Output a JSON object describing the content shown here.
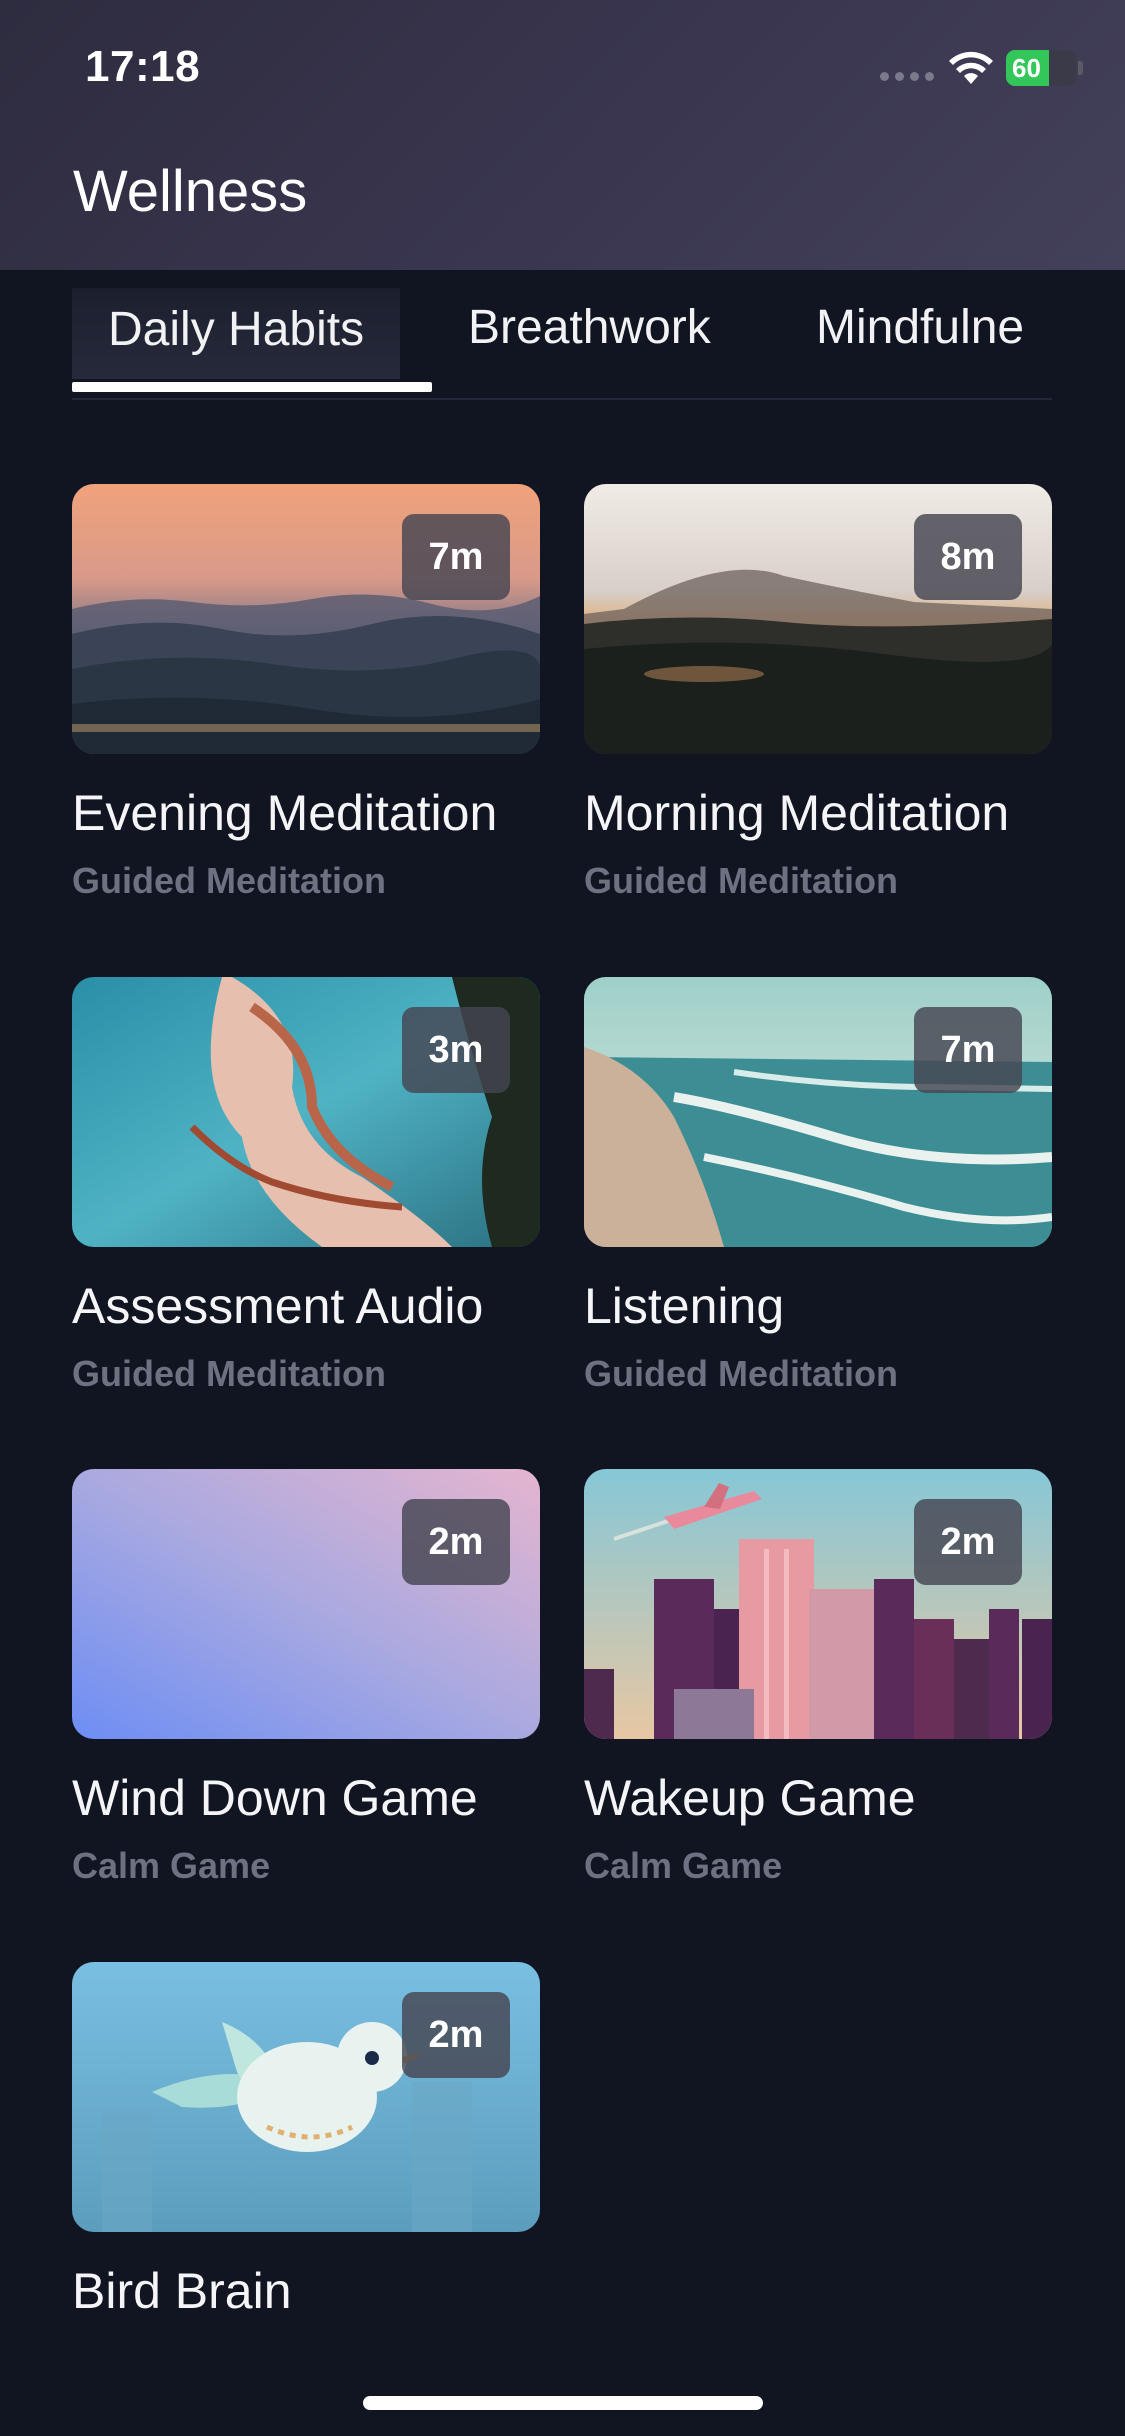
{
  "status_bar": {
    "time": "17:18",
    "battery": "60"
  },
  "header": {
    "title": "Wellness"
  },
  "tabs": [
    {
      "label": "Daily Habits",
      "active": true
    },
    {
      "label": "Breathwork",
      "active": false
    },
    {
      "label": "Mindfulne",
      "active": false
    }
  ],
  "cards": [
    {
      "title": "Evening Meditation",
      "subtitle": "Guided Meditation",
      "duration": "7m",
      "image": "sunset-mountains"
    },
    {
      "title": "Morning Meditation",
      "subtitle": "Guided Meditation",
      "duration": "8m",
      "image": "sunrise-forest"
    },
    {
      "title": "Assessment Audio",
      "subtitle": "Guided Meditation",
      "duration": "3m",
      "image": "aerial-coastline"
    },
    {
      "title": "Listening",
      "subtitle": "Guided Meditation",
      "duration": "7m",
      "image": "beach-waves"
    },
    {
      "title": "Wind Down Game",
      "subtitle": "Calm Game",
      "duration": "2m",
      "image": "purple-gradient"
    },
    {
      "title": "Wakeup Game",
      "subtitle": "Calm Game",
      "duration": "2m",
      "image": "city-airplane"
    },
    {
      "title": "Bird Brain",
      "subtitle": "",
      "duration": "2m",
      "image": "bird-illustration"
    }
  ],
  "colors": {
    "background": "#111522",
    "badge": "#464652",
    "subtitle": "#6d7282",
    "tab_underline": "#ffffff"
  }
}
